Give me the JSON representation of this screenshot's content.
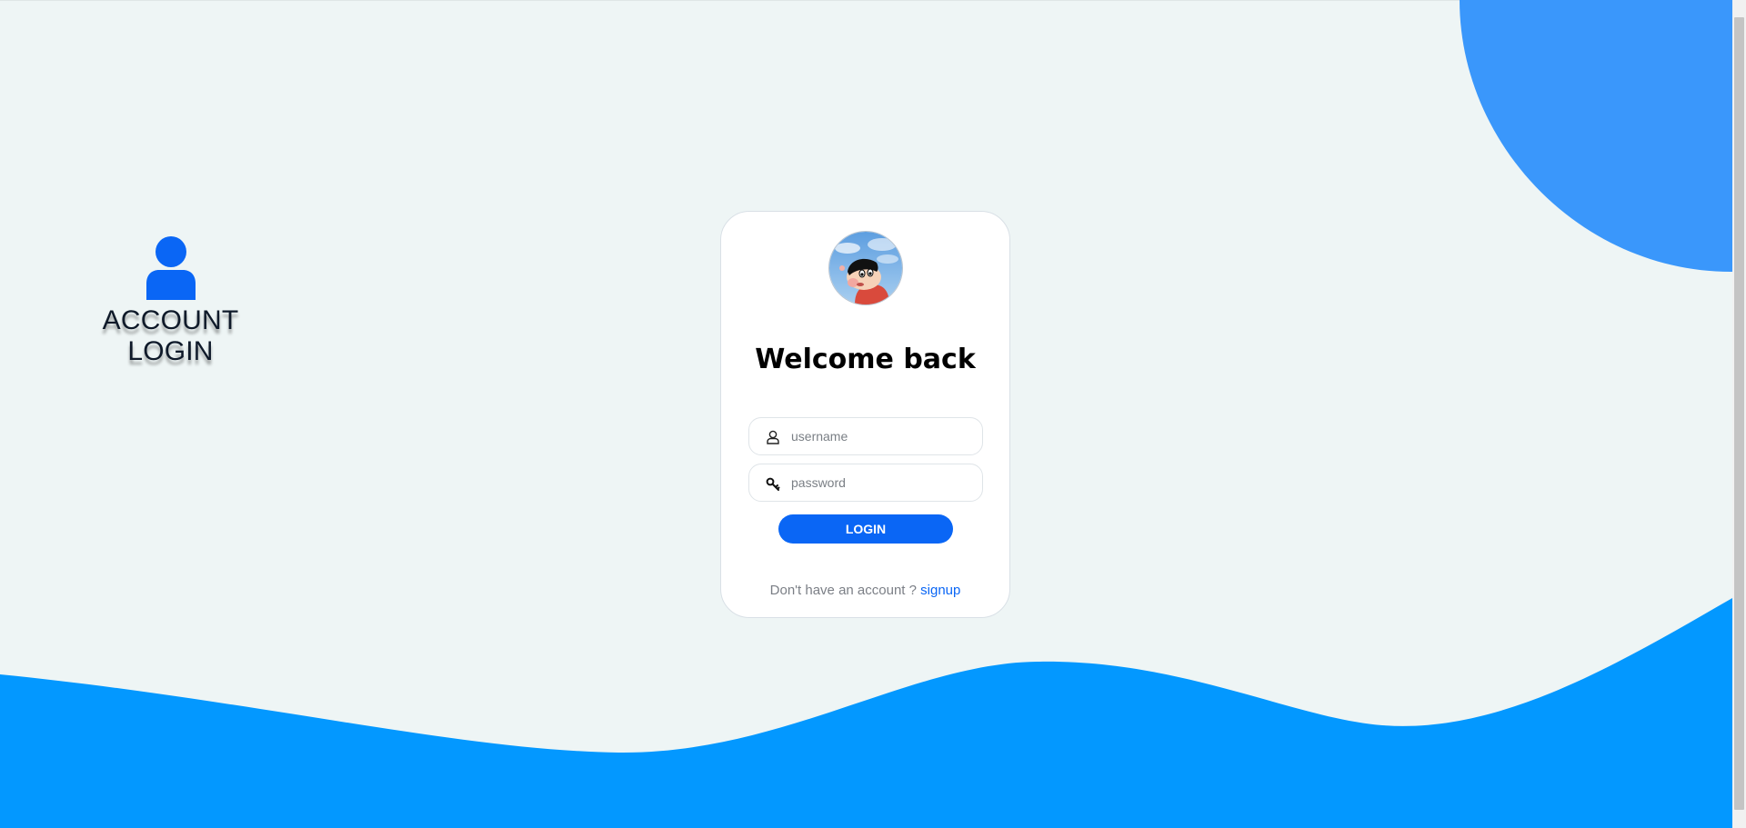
{
  "brand": {
    "title": "ACCOUNT LOGIN",
    "icon": "user-icon"
  },
  "card": {
    "avatar_alt": "avatar",
    "title": "Welcome back",
    "username": {
      "placeholder": "username",
      "value": "",
      "icon": "user-outline-icon"
    },
    "password": {
      "placeholder": "password",
      "value": "",
      "icon": "key-icon"
    },
    "login_label": "LOGIN",
    "signup_prompt": "Don't have an account ?",
    "signup_link": "signup"
  },
  "colors": {
    "background": "#eef5f5",
    "accent": "#0a66f5",
    "wave": "#0398ff",
    "corner_blob": "#3a97fb"
  }
}
